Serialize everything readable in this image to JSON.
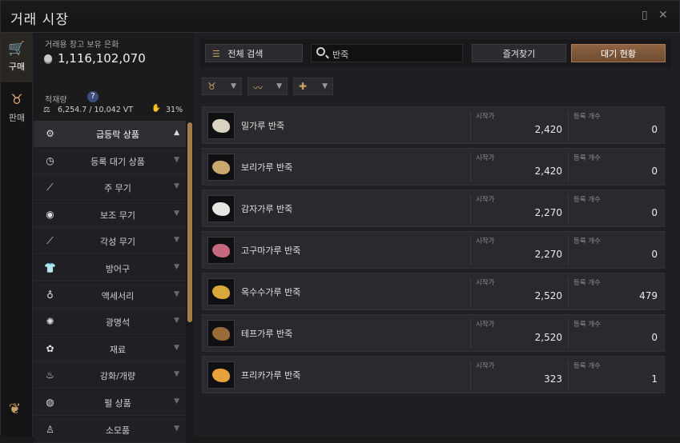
{
  "window": {
    "title": "거래 시장"
  },
  "rail": {
    "buy_label": "구매",
    "sell_label": "판매"
  },
  "wallet": {
    "label": "거래용 창고 보유 은화",
    "amount": "1,116,102,070",
    "weight_label": "적재량",
    "weight_value": "6,254.7 / 10,042 VT",
    "percent": "31%"
  },
  "toolbar": {
    "all_search_label": "전체 검색",
    "search_value": "반죽",
    "favorites_label": "즐겨찾기",
    "waitlist_label": "대기 현황"
  },
  "categories": [
    {
      "label": "급등락 상품",
      "icon": "gear-icon",
      "glyph": "⚙"
    },
    {
      "label": "등록 대기 상품",
      "icon": "clock-icon",
      "glyph": "◷"
    },
    {
      "label": "주 무기",
      "icon": "sword-icon",
      "glyph": "⟋"
    },
    {
      "label": "보조 무기",
      "icon": "shield-icon",
      "glyph": "◉"
    },
    {
      "label": "각성 무기",
      "icon": "awakening-weapon-icon",
      "glyph": "⟋"
    },
    {
      "label": "방어구",
      "icon": "armor-icon",
      "glyph": "👕"
    },
    {
      "label": "액세서리",
      "icon": "ring-icon",
      "glyph": "♁"
    },
    {
      "label": "광명석",
      "icon": "crystal-icon",
      "glyph": "✺"
    },
    {
      "label": "재료",
      "icon": "material-icon",
      "glyph": "✿"
    },
    {
      "label": "강화/개량",
      "icon": "upgrade-icon",
      "glyph": "♨"
    },
    {
      "label": "펄 상품",
      "icon": "pearl-icon",
      "glyph": "◍"
    },
    {
      "label": "소모품",
      "icon": "potion-icon",
      "glyph": "♙"
    }
  ],
  "columns": {
    "price": "시작가",
    "count": "등록 개수"
  },
  "items": [
    {
      "name": "밀가루 반죽",
      "price": "2,420",
      "count": "0",
      "color": "#d9d2c0"
    },
    {
      "name": "보리가루 반죽",
      "price": "2,420",
      "count": "0",
      "color": "#c9a76f"
    },
    {
      "name": "감자가루 반죽",
      "price": "2,270",
      "count": "0",
      "color": "#e6e6e3"
    },
    {
      "name": "고구마가루 반죽",
      "price": "2,270",
      "count": "0",
      "color": "#c56a7e"
    },
    {
      "name": "옥수수가루 반죽",
      "price": "2,520",
      "count": "479",
      "color": "#d9a83a"
    },
    {
      "name": "테프가루 반죽",
      "price": "2,520",
      "count": "0",
      "color": "#9b6a39"
    },
    {
      "name": "프리카가루 반죽",
      "price": "323",
      "count": "1",
      "color": "#e8a23b"
    }
  ]
}
